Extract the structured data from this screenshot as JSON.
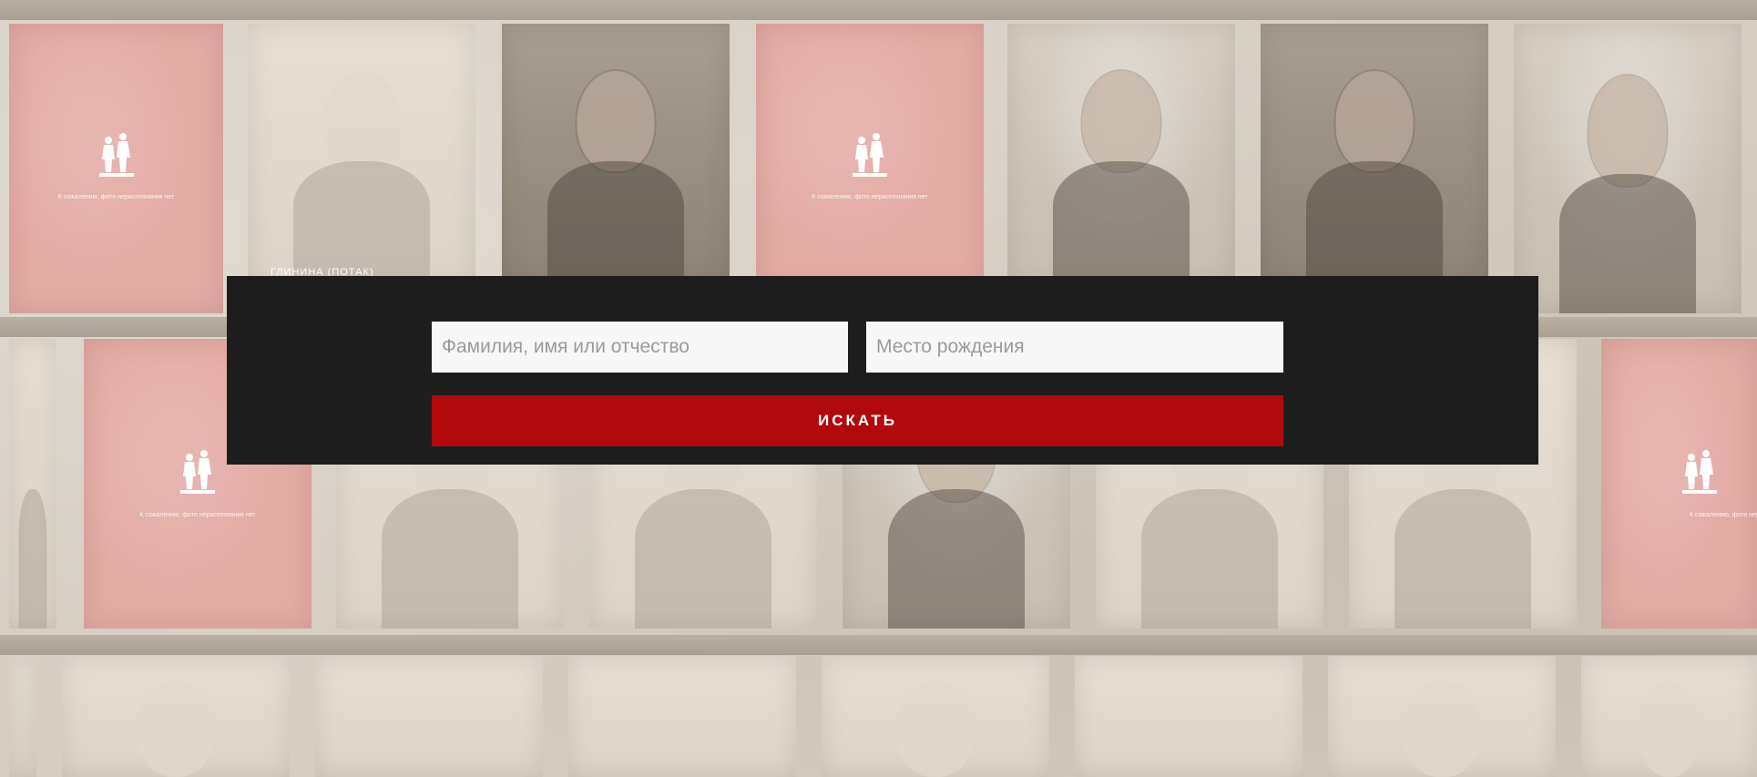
{
  "colors": {
    "panel_background": "#1d1d1d",
    "search_button": "#b2090d",
    "placeholder_card": "#e4aaa4",
    "page_background": "#d6cec3"
  },
  "background_wall": {
    "placeholder_caption": "К сожалению, фото нераспознания нет",
    "visible_name_label": "ГЛИНИНА (ПОТАК)",
    "placeholder_icon": "monument-icon"
  },
  "search": {
    "name_placeholder": "Фамилия, имя или отчество",
    "birthplace_placeholder": "Место рождения",
    "button_label": "ИСКАТЬ"
  }
}
